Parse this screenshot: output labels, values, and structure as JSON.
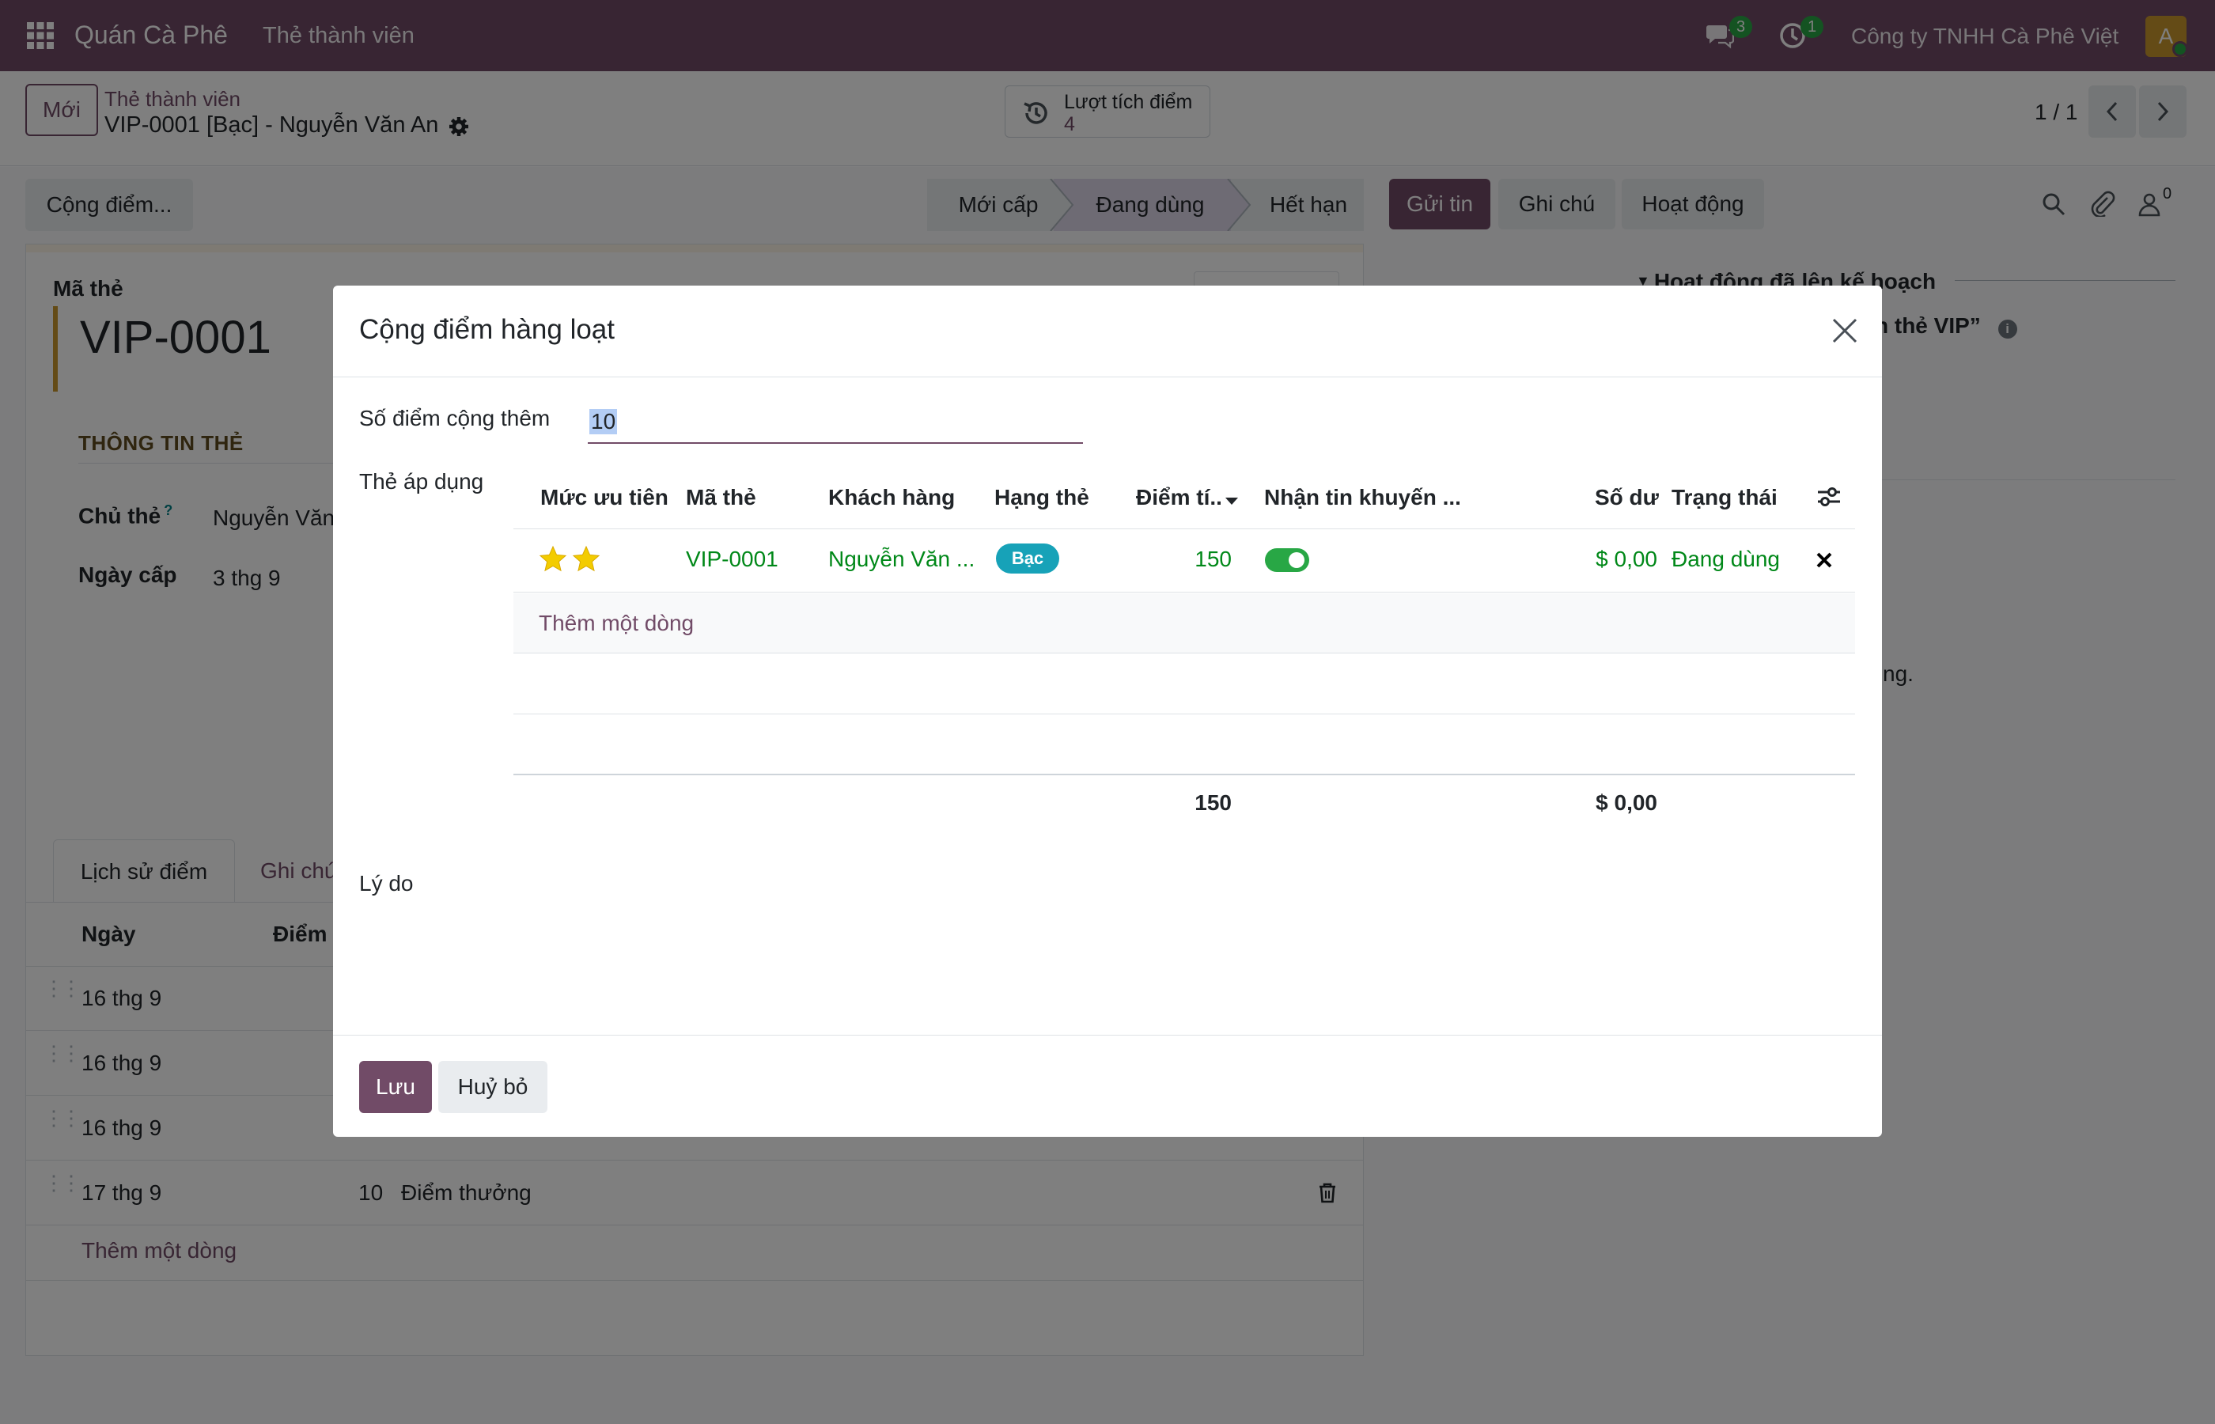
{
  "navbar": {
    "app_name": "Quán Cà Phê",
    "menu": "Thẻ thành viên",
    "messages_count": "3",
    "activities_count": "1",
    "company": "Công ty TNHH Cà Phê Việt",
    "avatar_letter": "A",
    "icons": [
      "apps-grid-icon",
      "chat-icon",
      "clock-icon"
    ]
  },
  "control": {
    "new_button": "Mới",
    "breadcrumb_parent": "Thẻ thành viên",
    "record_title": "VIP-0001 [Bạc] - Nguyễn Văn An",
    "smart_button_label": "Lượt tích điểm",
    "smart_button_count": "4",
    "pager": "1 / 1"
  },
  "statusbar": {
    "action_button": "Cộng điểm...",
    "stages": [
      "Mới cấp",
      "Đang dùng",
      "Hết hạn"
    ],
    "active_stage": "Đang dùng"
  },
  "chatter": {
    "send_message": "Gửi tin",
    "log_note": "Ghi chú",
    "activities": "Hoạt động",
    "followers_count": "0",
    "planned_header": "Hoạt động đã lên kế hoạch",
    "planned_item": "n thẻ VIP”",
    "note_fragment": "ng."
  },
  "form": {
    "card_code_label": "Mã thẻ",
    "card_code": "VIP-0001",
    "section_title": "THÔNG TIN THẺ",
    "holder_label": "Chủ thẻ",
    "holder_help": "?",
    "holder_value": "Nguyễn Văn",
    "issued_label": "Ngày cấp",
    "issued_value": "3 thg 9",
    "tabs": [
      "Lịch sử điểm",
      "Ghi chú"
    ],
    "history_headers": [
      "Ngày",
      "Điểm"
    ],
    "history_rows": [
      {
        "date": "16 thg 9",
        "points": "",
        "reason": ""
      },
      {
        "date": "16 thg 9",
        "points": "",
        "reason": ""
      },
      {
        "date": "16 thg 9",
        "points": "",
        "reason": ""
      },
      {
        "date": "17 thg 9",
        "points": "10",
        "reason": "Điểm thưởng"
      }
    ],
    "add_line": "Thêm một dòng"
  },
  "modal": {
    "title": "Cộng điểm hàng loạt",
    "points_label": "Số điểm cộng thêm",
    "points_value": "10",
    "cards_label": "Thẻ áp dụng",
    "columns": [
      "Mức ưu tiên",
      "Mã thẻ",
      "Khách hàng",
      "Hạng thẻ",
      "Điểm tí..",
      "Nhận tin khuyến ...",
      "Số dư",
      "Trạng thái"
    ],
    "rows": [
      {
        "priority_stars": 2,
        "code": "VIP-0001",
        "customer": "Nguyễn Văn ...",
        "tier": "Bạc",
        "points": "150",
        "promo_opt_in": true,
        "balance": "$ 0,00",
        "status": "Đang dùng"
      }
    ],
    "add_line": "Thêm một dòng",
    "total_points": "150",
    "total_balance": "$ 0,00",
    "reason_label": "Lý do",
    "save": "Lưu",
    "cancel": "Huỷ bỏ"
  },
  "colors": {
    "brand": "#714B67",
    "success": "#28a745",
    "tier_badge": "#17a2b8",
    "star": "#f3cc00"
  }
}
